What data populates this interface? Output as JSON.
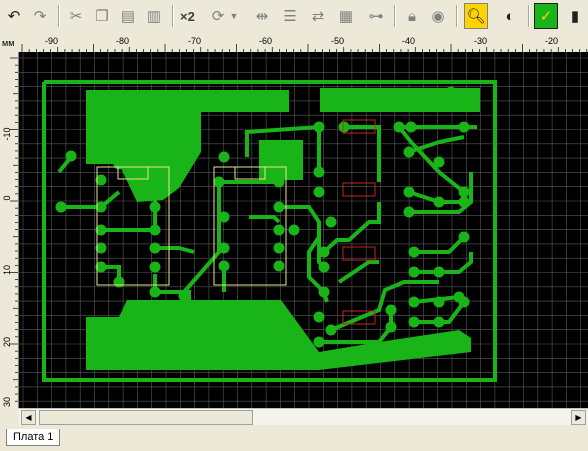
{
  "toolbar": {
    "multiply_label": "×2",
    "buttons": [
      "undo-icon",
      "redo-icon",
      "cut-icon",
      "copy-icon",
      "paste-icon",
      "delete-icon",
      "multiply",
      "rotate-icon",
      "rotate-dropdown-icon",
      "mirror-vertical-icon",
      "align-icon",
      "autoroute-icon",
      "grid-icon",
      "connections-icon",
      "lock-icon",
      "unlock-icon",
      "zoom-icon",
      "layer-color-icon",
      "drc-icon",
      "tool-icon"
    ]
  },
  "ruler": {
    "unit": "мм",
    "top_labels": [
      "-90",
      "-80",
      "-70",
      "-60",
      "-50",
      "-40",
      "-30",
      "-20"
    ],
    "left_labels": [
      "-10",
      "0",
      "10",
      "20",
      "30"
    ]
  },
  "tabs": [
    {
      "label": "Плата 1"
    }
  ],
  "colors": {
    "board_bg": "#000000",
    "grid": "#5a5a5a",
    "copper": "#18b418",
    "silkscreen": "#e6e68c",
    "marker": "#cc2222"
  }
}
